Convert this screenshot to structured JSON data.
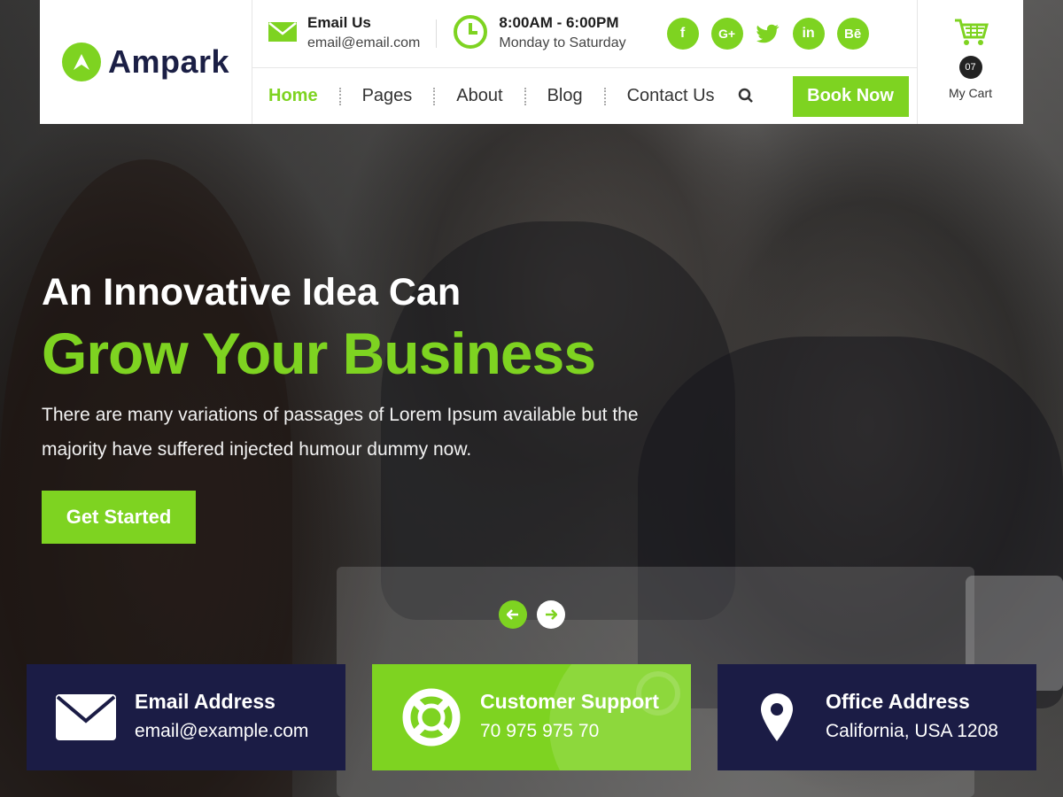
{
  "brand": {
    "name": "Ampark",
    "accent": "#7ed321",
    "navy": "#1b1c45"
  },
  "topbar": {
    "email": {
      "title": "Email Us",
      "value": "email@email.com",
      "icon": "envelope-icon"
    },
    "hours": {
      "title": "8:00AM - 6:00PM",
      "value": "Monday to Saturday",
      "icon": "clock-icon"
    },
    "socials": [
      {
        "name": "facebook",
        "glyph": "f"
      },
      {
        "name": "google-plus",
        "glyph": "G+"
      },
      {
        "name": "twitter",
        "glyph": "🐦"
      },
      {
        "name": "linkedin",
        "glyph": "in"
      },
      {
        "name": "behance",
        "glyph": "Bē"
      }
    ]
  },
  "nav": {
    "items": [
      {
        "label": "Home",
        "active": true
      },
      {
        "label": "Pages"
      },
      {
        "label": "About"
      },
      {
        "label": "Blog"
      },
      {
        "label": "Contact Us"
      }
    ],
    "search_icon": "search-icon",
    "cta": "Book Now"
  },
  "cart": {
    "count": "07",
    "label": "My Cart",
    "icon": "cart-icon"
  },
  "hero": {
    "line1": "An Innovative Idea Can",
    "line2": "Grow Your Business",
    "description": "There are many variations of passages of Lorem Ipsum available but the majority have suffered injected humour dummy now.",
    "button": "Get Started"
  },
  "cards": [
    {
      "title": "Email Address",
      "value": "email@example.com",
      "icon": "envelope-icon"
    },
    {
      "title": "Customer Support",
      "value": "70 975 975 70",
      "icon": "lifebuoy-icon"
    },
    {
      "title": "Office Address",
      "value": "California, USA 1208",
      "icon": "map-pin-icon"
    }
  ]
}
